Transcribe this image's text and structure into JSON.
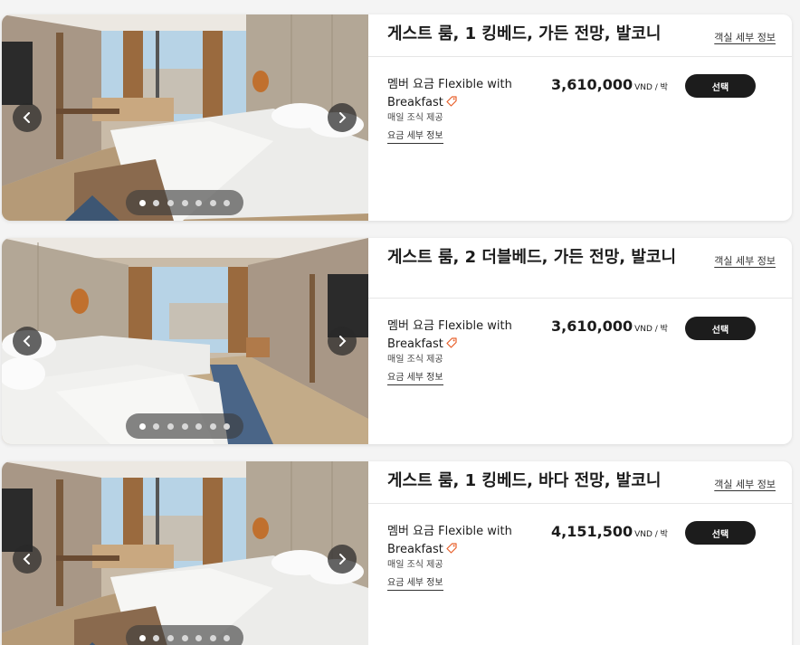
{
  "rooms": [
    {
      "title": "게스트 룸, 1 킹베드, 가든 전망, 발코니",
      "room_details_label": "객실 세부 정보",
      "rate_name": "멤버 요금 Flexible with Breakfast",
      "rate_sub": "매일 조식 제공",
      "rate_details_label": "요금 세부 정보",
      "price": "3,610,000",
      "price_unit": "VND / 박",
      "select_label": "선택",
      "bed_layout": "king",
      "photo_count": 7
    },
    {
      "title": "게스트 룸, 2 더블베드, 가든 전망, 발코니",
      "room_details_label": "객실 세부 정보",
      "rate_name": "멤버 요금 Flexible with Breakfast",
      "rate_sub": "매일 조식 제공",
      "rate_details_label": "요금 세부 정보",
      "price": "3,610,000",
      "price_unit": "VND / 박",
      "select_label": "선택",
      "bed_layout": "double",
      "photo_count": 7
    },
    {
      "title": "게스트 룸, 1 킹베드, 바다 전망, 발코니",
      "room_details_label": "객실 세부 정보",
      "rate_name": "멤버 요금 Flexible with Breakfast",
      "rate_sub": "매일 조식 제공",
      "rate_details_label": "요금 세부 정보",
      "price": "4,151,500",
      "price_unit": "VND / 박",
      "select_label": "선택",
      "bed_layout": "king",
      "photo_count": 7
    }
  ],
  "icons": {
    "prev": "chevron-left-icon",
    "next": "chevron-right-icon",
    "member_rate": "tag-icon"
  },
  "colors": {
    "button_bg": "#1c1c1c",
    "tag_icon": "#e8612c",
    "card_bg": "#ffffff",
    "page_bg": "#f4f4f4"
  }
}
